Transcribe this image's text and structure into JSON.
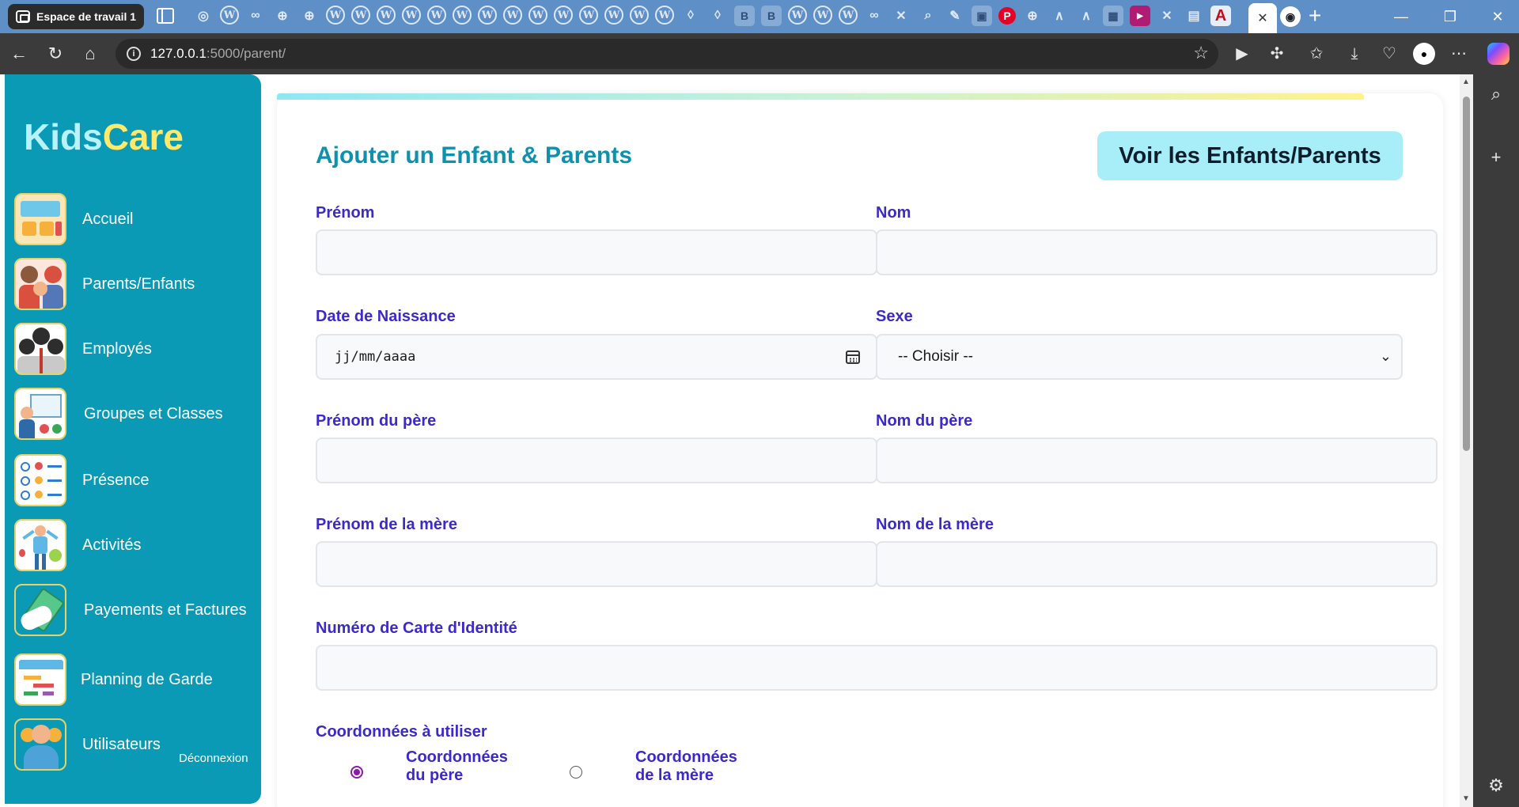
{
  "browser": {
    "workspace_label": "Espace de travail 1",
    "url_host": "127.0.0.1",
    "url_path": ":5000/parent/"
  },
  "sidebar": {
    "logo_part1": "Kids",
    "logo_part2": "Care",
    "items": [
      {
        "label": "Accueil",
        "icon": "dashboard-icon"
      },
      {
        "label": "Parents/Enfants",
        "icon": "family-icon"
      },
      {
        "label": "Employés",
        "icon": "employees-icon"
      },
      {
        "label": "Groupes et Classes",
        "icon": "classroom-icon"
      },
      {
        "label": "Présence",
        "icon": "attendance-icon"
      },
      {
        "label": "Activités",
        "icon": "activities-icon"
      },
      {
        "label": "Payements et Factures",
        "icon": "payment-icon"
      },
      {
        "label": "Planning de Garde",
        "icon": "calendar-icon"
      },
      {
        "label": "Utilisateurs",
        "icon": "users-icon"
      }
    ],
    "logout_label": "Déconnexion"
  },
  "form": {
    "title": "Ajouter un Enfant & Parents",
    "view_button": "Voir les Enfants/Parents",
    "fields": {
      "prenom": {
        "label": "Prénom",
        "value": ""
      },
      "nom": {
        "label": "Nom",
        "value": ""
      },
      "date_naissance": {
        "label": "Date de Naissance",
        "placeholder": "jj/mm/aaaa"
      },
      "sexe": {
        "label": "Sexe",
        "selected": "-- Choisir --"
      },
      "prenom_pere": {
        "label": "Prénom du père",
        "value": ""
      },
      "nom_pere": {
        "label": "Nom du père",
        "value": ""
      },
      "prenom_mere": {
        "label": "Prénom de la mère",
        "value": ""
      },
      "nom_mere": {
        "label": "Nom de la mère",
        "value": ""
      },
      "cin": {
        "label": "Numéro de Carte d'Identité",
        "value": ""
      }
    },
    "coordonnees": {
      "label": "Coordonnées à utiliser",
      "options": [
        {
          "label_line1": "Coordonnées",
          "label_line2": "du père",
          "checked": true
        },
        {
          "label_line1": "Coordonnées",
          "label_line2": "de la mère",
          "checked": false
        }
      ]
    }
  },
  "colors": {
    "sidebar_bg": "#0b9ab6",
    "title": "#0d91ad",
    "label": "#3b2ac8",
    "button_bg": "#a8eef9",
    "logo_kids": "#b8f2fb",
    "logo_care": "#ffe96b"
  }
}
